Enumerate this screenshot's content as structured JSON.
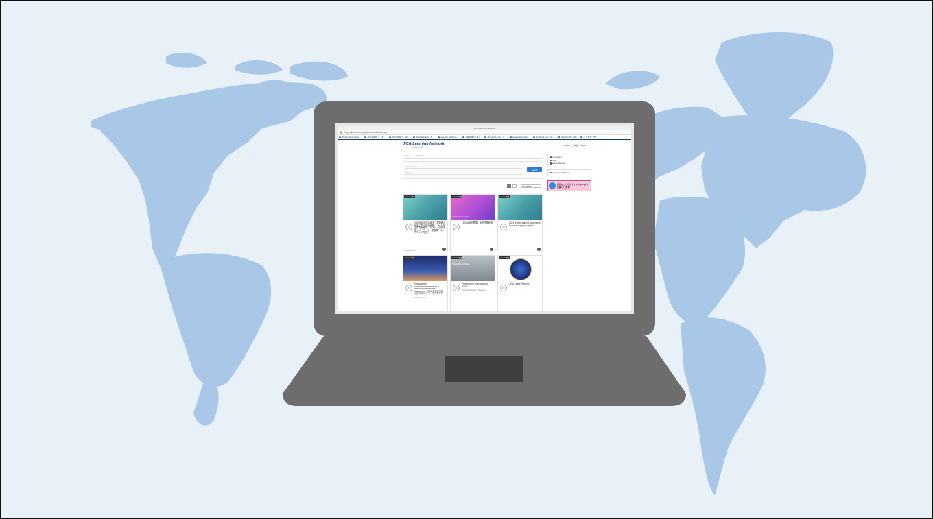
{
  "browser": {
    "window_title": "JICA-Learning Network",
    "address": "https://jica-net.jica.go.jp/course/default.aspx",
    "bookmarks": [
      "JICA-Learning Netw...",
      "JICA-MASP (-_ 19...",
      "JICA-MASP (-_ 19...",
      "JICA Navigation : R...",
      "e-setting MediTree...",
      "人事管理ポータル",
      "JICA Net Library - T...",
      "dynabook.com[家...",
      "dynabook.com 今夜...",
      "dynaCloud[ご案内",
      "ビジネス・サイト"
    ]
  },
  "site": {
    "logo": "JICA-Learning Network",
    "logo_sub": "Knowledge Site",
    "header_links": [
      "English",
      "日本語",
      "Logout"
    ]
  },
  "tabs": [
    {
      "label": "Courses",
      "active": true
    },
    {
      "label": "Ratings",
      "active": false
    }
  ],
  "search": {
    "keyword_placeholder": "Keyword Input",
    "tag_placeholder": "Tag Select",
    "button_label": "Search"
  },
  "filter": {
    "label": "All Courses"
  },
  "courses": [
    {
      "tag": "JICA-NET専用",
      "progress": "0%",
      "title": "2020年度経営の新規（問題解決編施工量の安全管理）- JICA 安全標準仕様書（2020）の説明を通じて - ワーク・業務集（オンデマンド形式）",
      "status": "Not started",
      "thumb": "teal"
    },
    {
      "tag": "JICA-NET専用",
      "progress": "0%",
      "title": "【JICA安全標準】安全所属研修",
      "status": "",
      "thumb": "pink",
      "overlay": "JICA Safety Standards"
    },
    {
      "tag": "JICA-NET専用",
      "progress": "0%",
      "title": "2023 remote training documents for water supply engineer",
      "status": "",
      "thumb": "teal"
    },
    {
      "tag": "JICA-NET専用",
      "progress": "0%",
      "title": "Повышение энергоэффективности и энергосбережения в Казахстане（省エネ技術促進・大型エネルギー）モデクンチ",
      "meta": "JICA-Net Kiosque",
      "thumb": "city"
    },
    {
      "tag": "JICA-NET専用",
      "progress": "0%",
      "title": "Project cycle management: PCM",
      "meta": "JICA-Net: Speakers for Beginners",
      "thumb": "pcm",
      "overlay": "The ABCs of PCM"
    },
    {
      "tag": "JICA-NET専用",
      "progress": "0%",
      "title": "JICA Space Platform",
      "thumb": "space"
    }
  ],
  "sidebar": {
    "items": [
      "Information",
      "FAQ",
      "Event Calendar"
    ],
    "settings": "Environment Settings",
    "banner": "質問はこちらのサイトのQ&Aより お願いします！"
  },
  "colors": {
    "map_land": "#a9c8e8",
    "background": "#e8f0f8",
    "laptop": "#6d6d6d",
    "accent": "#2a7ad5"
  }
}
